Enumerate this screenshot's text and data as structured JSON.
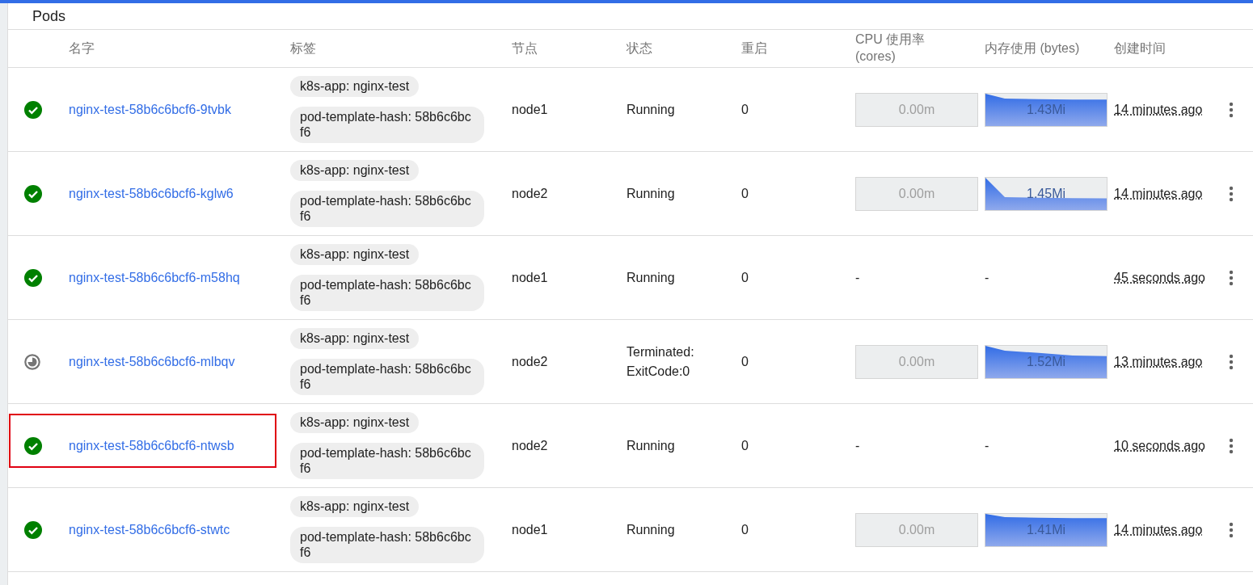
{
  "title": "Pods",
  "columns": [
    "名字",
    "标签",
    "节点",
    "状态",
    "重启",
    "CPU 使用率 (cores)",
    "内存使用 (bytes)",
    "创建时间"
  ],
  "rows": [
    {
      "kind": "running",
      "name": "nginx-test-58b6c6bcf6-9tvbk",
      "labels": [
        "k8s-app: nginx-test",
        "pod-template-hash: 58b6c6bcf6"
      ],
      "node": "node1",
      "status": "Running",
      "restarts": "0",
      "cpu": "0.00m",
      "memory": "1.43Mi",
      "created": "14 minutes ago",
      "highlighted": false
    },
    {
      "kind": "running",
      "name": "nginx-test-58b6c6bcf6-kglw6",
      "labels": [
        "k8s-app: nginx-test",
        "pod-template-hash: 58b6c6bcf6"
      ],
      "node": "node2",
      "status": "Running",
      "restarts": "0",
      "cpu": "0.00m",
      "memory": "1.45Mi",
      "created": "14 minutes ago",
      "highlighted": false
    },
    {
      "kind": "running",
      "name": "nginx-test-58b6c6bcf6-m58hq",
      "labels": [
        "k8s-app: nginx-test",
        "pod-template-hash: 58b6c6bcf6"
      ],
      "node": "node1",
      "status": "Running",
      "restarts": "0",
      "cpu": "-",
      "memory": "-",
      "created": "45 seconds ago",
      "highlighted": false
    },
    {
      "kind": "terminated",
      "name": "nginx-test-58b6c6bcf6-mlbqv",
      "labels": [
        "k8s-app: nginx-test",
        "pod-template-hash: 58b6c6bcf6"
      ],
      "node": "node2",
      "status": "Terminated: ExitCode:0",
      "restarts": "0",
      "cpu": "0.00m",
      "memory": "1.52Mi",
      "created": "13 minutes ago",
      "highlighted": false
    },
    {
      "kind": "running",
      "name": "nginx-test-58b6c6bcf6-ntwsb",
      "labels": [
        "k8s-app: nginx-test",
        "pod-template-hash: 58b6c6bcf6"
      ],
      "node": "node2",
      "status": "Running",
      "restarts": "0",
      "cpu": "-",
      "memory": "-",
      "created": "10 seconds ago",
      "highlighted": true
    },
    {
      "kind": "running",
      "name": "nginx-test-58b6c6bcf6-stwtc",
      "labels": [
        "k8s-app: nginx-test",
        "pod-template-hash: 58b6c6bcf6"
      ],
      "node": "node1",
      "status": "Running",
      "restarts": "0",
      "cpu": "0.00m",
      "memory": "1.41Mi",
      "created": "14 minutes ago",
      "highlighted": false
    }
  ]
}
